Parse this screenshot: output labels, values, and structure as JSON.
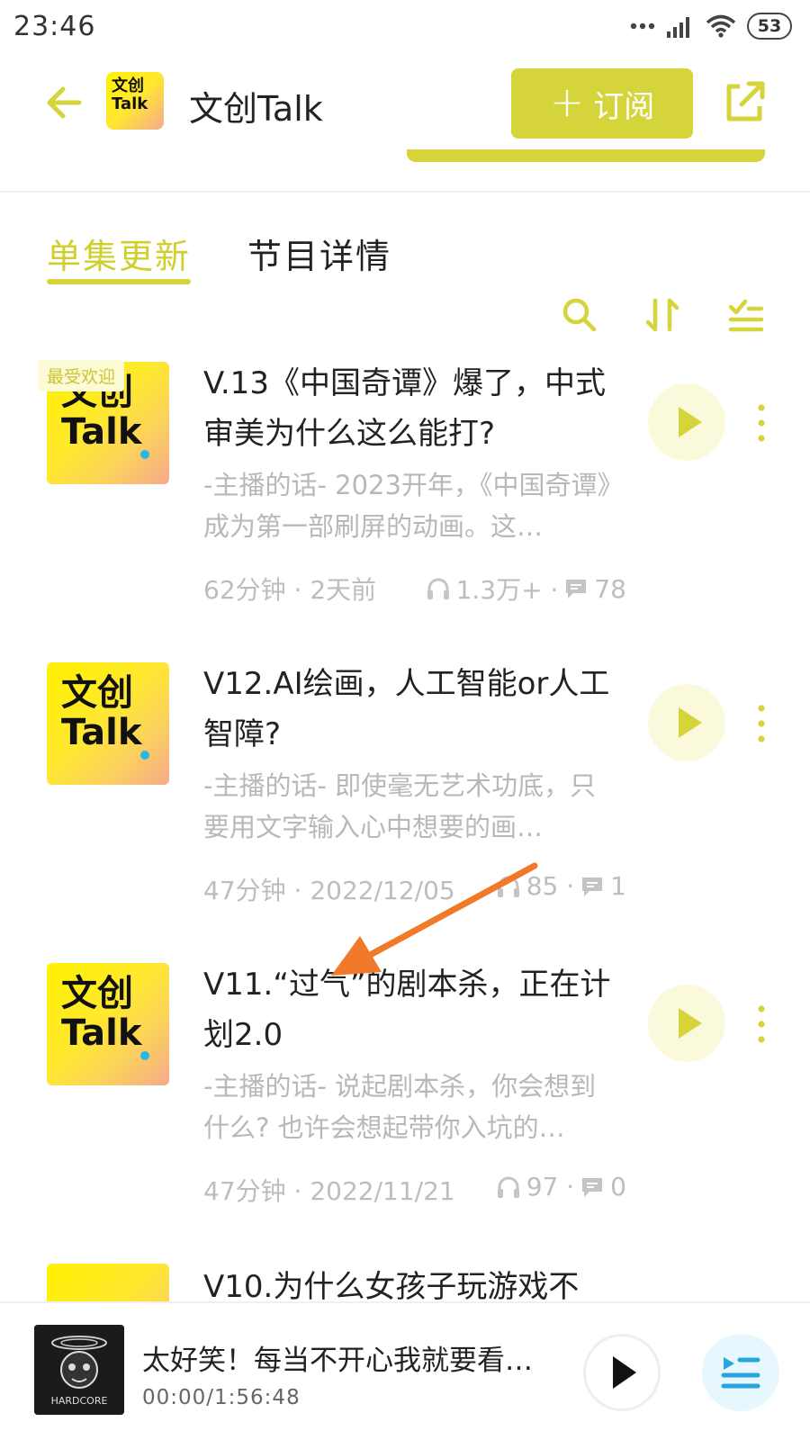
{
  "status_bar": {
    "time": "23:46",
    "battery": "53"
  },
  "header": {
    "podcast_title": "文创Talk",
    "subscribe_label": "订阅",
    "logo_text_line1": "文创",
    "logo_text_line2": "Talk"
  },
  "tabs": [
    {
      "label": "单集更新",
      "active": true
    },
    {
      "label": "节目详情",
      "active": false
    }
  ],
  "episodes": [
    {
      "badge": "最受欢迎",
      "cover_line1": "文创",
      "cover_line2": "Talk",
      "title": "V.13《中国奇谭》爆了，中式审美为什么这么能打?",
      "description": "-主播的话- 2023开年，《中国奇谭》成为第一部刷屏的动画。这…",
      "duration_date": "62分钟 · 2天前",
      "plays": "1.3万+ ·",
      "comments": "78"
    },
    {
      "cover_line1": "文创",
      "cover_line2": "Talk",
      "title": "V12.AI绘画，人工智能or人工智障?",
      "description": "-主播的话- 即使毫无艺术功底，只要用文字输入心中想要的画…",
      "duration_date": "47分钟 · 2022/12/05",
      "plays": "85 ·",
      "comments": "1"
    },
    {
      "cover_line1": "文创",
      "cover_line2": "Talk",
      "title": "V11.“过气”的剧本杀，正在计划2.0",
      "description": "-主播的话- 说起剧本杀，你会想到什么? 也许会想起带你入坑的…",
      "duration_date": "47分钟 · 2022/11/21",
      "plays": "97 ·",
      "comments": "0"
    },
    {
      "title": "V10.为什么女孩子玩游戏不"
    }
  ],
  "player": {
    "title": "太好笑！每当不开心我就要看…",
    "time": "00:00/1:56:48",
    "cover_text": "HARDCORE"
  },
  "colors": {
    "accent": "#d5d43a",
    "accent_text": "#d0cf2e",
    "play_bg": "#fbf9dc",
    "annotation_arrow": "#f07a2a"
  }
}
